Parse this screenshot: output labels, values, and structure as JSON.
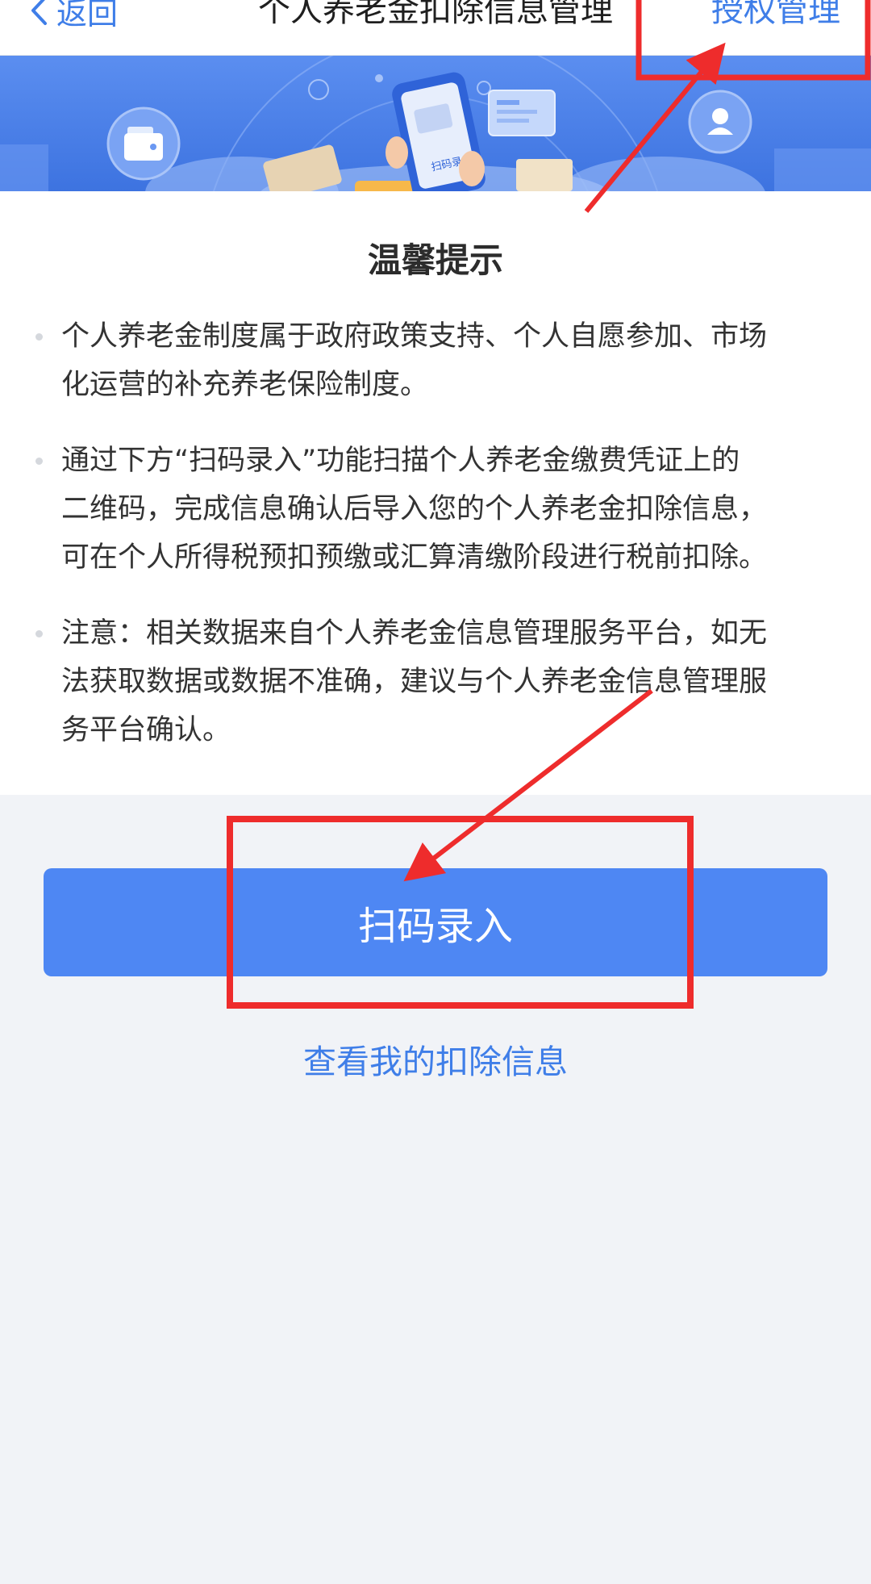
{
  "nav": {
    "back_label": "返回",
    "title": "个人养老金扣除信息管理",
    "auth_label": "授权管理"
  },
  "banner": {
    "phone_text": "扫码录入",
    "colors": {
      "bg_top": "#5b8ef0",
      "bg_bottom": "#3d73e0"
    }
  },
  "notice": {
    "title": "温馨提示",
    "items": [
      {
        "line1": "个人养老金制度属于政府政策支持、个人自愿参加、市场",
        "line2": "化运营的补充养老保险制度。",
        "line3": ""
      },
      {
        "line1": "通过下方“扫码录入”功能扫描个人养老金缴费凭证上的",
        "line2": "二维码，完成信息确认后导入您的个人养老金扣除信息，",
        "line3": "可在个人所得税预扣预缴或汇算清缴阶段进行税前扣除。"
      },
      {
        "line1": "注意：相关数据来自个人养老金信息管理服务平台，如无",
        "line2": "法获取数据或数据不准确，建议与个人养老金信息管理服",
        "line3": "务平台确认。"
      }
    ]
  },
  "actions": {
    "scan_label": "扫码录入",
    "view_label": "查看我的扣除信息"
  },
  "colors": {
    "accent": "#4e87f3",
    "link": "#3f7ee8",
    "annotation": "#ee2c2c"
  }
}
